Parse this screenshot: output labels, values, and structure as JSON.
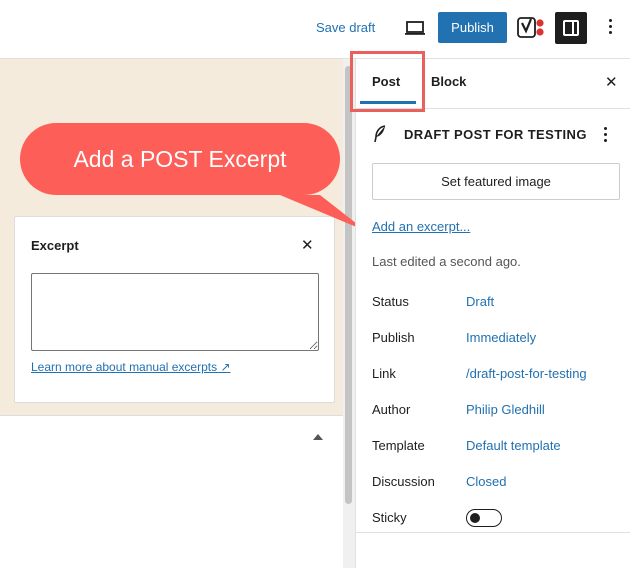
{
  "header": {
    "save_draft": "Save draft",
    "publish": "Publish",
    "accent_color": "#2271b1"
  },
  "callout": {
    "text": "Add a POST Excerpt",
    "color": "#fd5e57"
  },
  "excerpt_panel": {
    "title": "Excerpt",
    "close": "✕",
    "textarea_value": "",
    "learn_more": "Learn more about manual excerpts ↗"
  },
  "sidebar": {
    "tabs": [
      {
        "label": "Post",
        "active": true
      },
      {
        "label": "Block",
        "active": false
      }
    ],
    "close": "✕",
    "post_title": "DRAFT POST FOR TESTING",
    "featured_image_button": "Set featured image",
    "add_excerpt": "Add an excerpt...",
    "last_edited": "Last edited a second ago.",
    "meta": [
      {
        "label": "Status",
        "value": "Draft"
      },
      {
        "label": "Publish",
        "value": "Immediately"
      },
      {
        "label": "Link",
        "value": "/draft-post-for-testing"
      },
      {
        "label": "Author",
        "value": "Philip Gledhill"
      },
      {
        "label": "Template",
        "value": "Default template"
      },
      {
        "label": "Discussion",
        "value": "Closed"
      },
      {
        "label": "Sticky",
        "value": ""
      }
    ],
    "sticky_on": false
  },
  "icons": [
    "laptop-icon",
    "yoast-icon",
    "sidebar-toggle-icon",
    "more-vertical-icon",
    "feather-icon",
    "close-icon",
    "chevron-up-icon"
  ]
}
